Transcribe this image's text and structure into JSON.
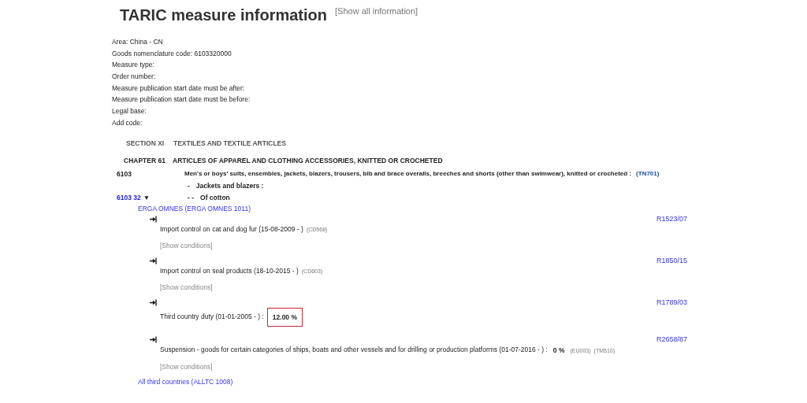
{
  "title": "TARIC measure information",
  "show_all_link": "[Show all information]",
  "criteria": [
    "Area: China - CN",
    "Goods nomenclature code: 6103320000",
    "Measure type:",
    "Order number:",
    "Measure publication start date must be after:",
    "Measure publication start date must be before:",
    "Legal base:",
    "Add code:"
  ],
  "section": {
    "code": "SECTION XI",
    "description": "TEXTILES AND TEXTILE ARTICLES"
  },
  "chapter": {
    "code": "CHAPTER 61",
    "description": "ARTICLES OF APPAREL AND CLOTHING ACCESSORIES, KNITTED OR CROCHETED"
  },
  "heading": {
    "code": "6103",
    "description": "Men's or boys' suits, ensembles, jackets, blazers, trousers, bib and brace overalls, breeches and shorts (other than swimwear), knitted or crocheted :",
    "note": "(TN701)"
  },
  "subheadings": [
    {
      "dashes": "-",
      "text": "Jackets and blazers :"
    },
    {
      "code": "6103 32",
      "toggle": "▼",
      "dashes": "- -",
      "text": "Of cotton"
    }
  ],
  "origins": [
    {
      "name": "ERGA OMNES (ERGA OMNES 1011)",
      "measures": [
        {
          "text": "Import control on cat and dog fur (15-08-2009 - )",
          "codes": [
            "(CD568)"
          ],
          "regulation": "R1523/07",
          "show_conditions": "[Show conditions]"
        },
        {
          "text": "Import control on seal products (18-10-2015 - )",
          "codes": [
            "(CD603)"
          ],
          "regulation": "R1850/15",
          "show_conditions": "[Show conditions]"
        },
        {
          "text": "Third country duty (01-01-2005 - ) :",
          "duty": "12.00 %",
          "regulation": "R1789/03",
          "highlighted": true
        },
        {
          "text": "Suspension - goods for certain categories of ships, boats and other vessels and for drilling or production platforms (01-07-2016 - ) :",
          "duty": "0 %",
          "codes": [
            "(EU003)",
            "(TM510)"
          ],
          "regulation": "R2658/87",
          "show_conditions": "[Show conditions]",
          "highlighted": false
        }
      ]
    },
    {
      "name": "All third countries (ALLTC 1008)"
    }
  ]
}
